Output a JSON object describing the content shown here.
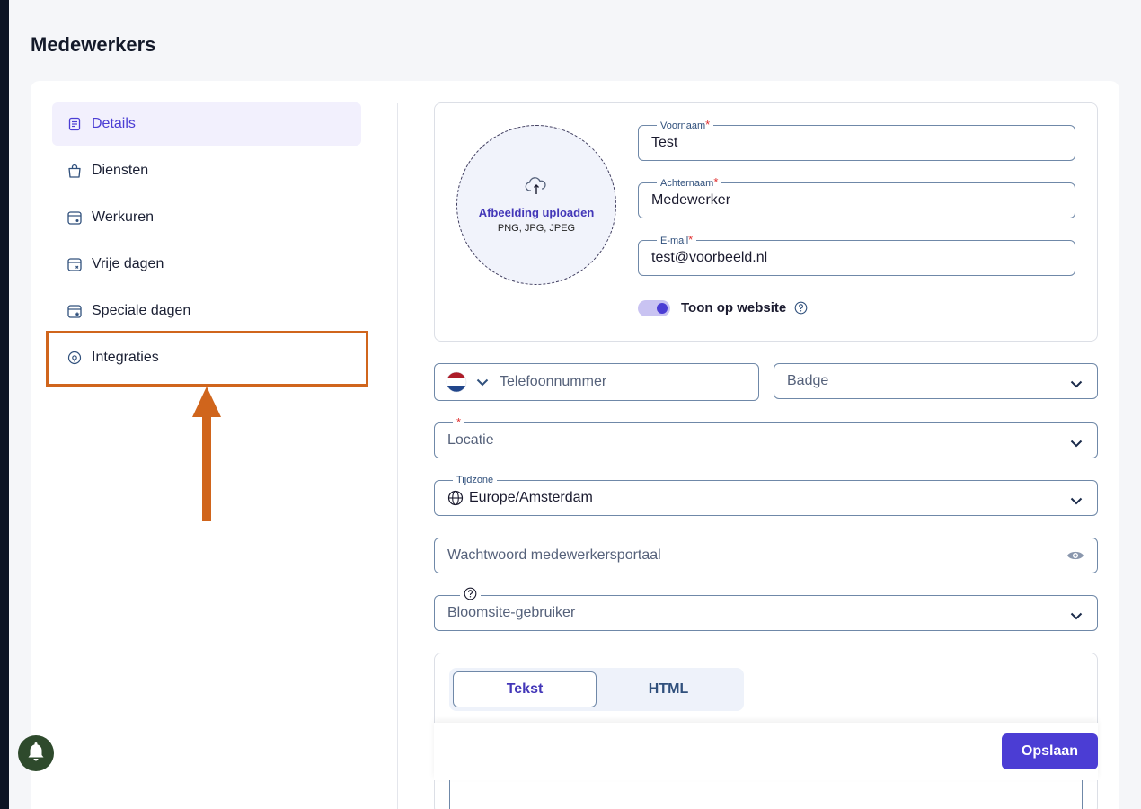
{
  "page": {
    "title": "Medewerkers"
  },
  "sidebar": {
    "items": [
      {
        "label": "Details",
        "icon": "document-icon",
        "active": true
      },
      {
        "label": "Diensten",
        "icon": "bag-icon"
      },
      {
        "label": "Werkuren",
        "icon": "calendar-clock-icon"
      },
      {
        "label": "Vrije dagen",
        "icon": "calendar-x-icon"
      },
      {
        "label": "Speciale dagen",
        "icon": "calendar-star-icon"
      },
      {
        "label": "Integraties",
        "icon": "plug-icon"
      }
    ]
  },
  "upload": {
    "title": "Afbeelding uploaden",
    "formats": "PNG, JPG, JPEG",
    "icon": "cloud-upload-icon"
  },
  "form": {
    "first_name": {
      "label": "Voornaam",
      "value": "Test",
      "required": "*"
    },
    "last_name": {
      "label": "Achternaam",
      "value": "Medewerker",
      "required": "*"
    },
    "email": {
      "label": "E-mail",
      "value": "test@voorbeeld.nl",
      "required": "*"
    },
    "show_on_website": {
      "label": "Toon op website",
      "enabled": true
    },
    "phone": {
      "placeholder": "Telefoonnummer",
      "country": "NL"
    },
    "badge": {
      "placeholder": "Badge"
    },
    "location": {
      "placeholder": "Locatie",
      "required": "*"
    },
    "timezone": {
      "label": "Tijdzone",
      "value": "Europe/Amsterdam"
    },
    "password": {
      "placeholder": "Wachtwoord medewerkersportaal"
    },
    "bloomsite_user": {
      "placeholder": "Bloomsite-gebruiker"
    }
  },
  "editor_tabs": {
    "text": "Tekst",
    "html": "HTML"
  },
  "actions": {
    "save": "Opslaan"
  },
  "colors": {
    "accent": "#4b3dd4",
    "annotation": "#d0651c",
    "border": "#6f88a8"
  }
}
